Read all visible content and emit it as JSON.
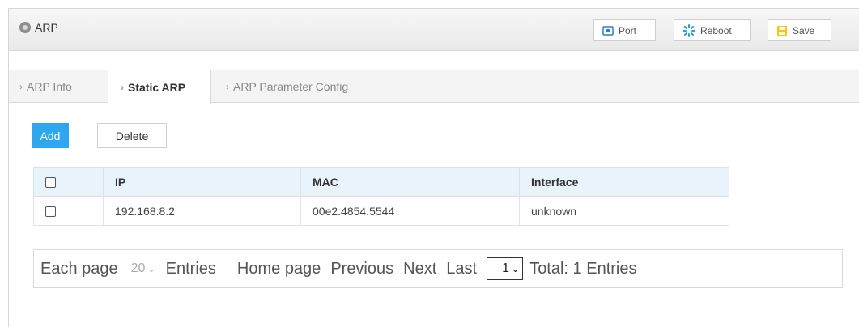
{
  "header": {
    "title": "ARP"
  },
  "toolbar": {
    "port_label": "Port",
    "reboot_label": "Reboot",
    "save_label": "Save"
  },
  "tabs": [
    {
      "label": "ARP Info"
    },
    {
      "label": "Static ARP"
    },
    {
      "label": "ARP Parameter Config"
    }
  ],
  "actions": {
    "add_label": "Add",
    "delete_label": "Delete"
  },
  "table": {
    "columns": [
      "IP",
      "MAC",
      "Interface"
    ],
    "rows": [
      {
        "ip": "192.168.8.2",
        "mac": "00e2.4854.5544",
        "interface": "unknown"
      }
    ]
  },
  "pager": {
    "each_page": "Each page",
    "per_page": "20",
    "entries": "Entries",
    "home": "Home page",
    "previous": "Previous",
    "next": "Next",
    "last": "Last",
    "page": "1",
    "total": "Total: 1 Entries"
  },
  "colors": {
    "accent": "#2ea7ef",
    "header_bg": "#e8f3fb"
  }
}
